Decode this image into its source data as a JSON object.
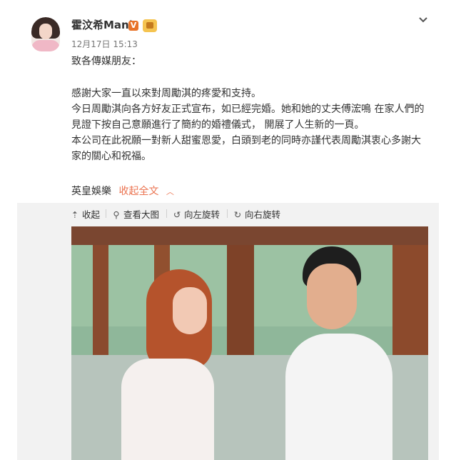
{
  "post": {
    "username": "霍汶希Mani",
    "verified_mark": "V",
    "timestamp": "12月17日 15:13",
    "greeting": "致各傳媒朋友：",
    "lines": [
      "感謝大家一直以來對周勵淇的疼愛和支持。",
      "今日周勵淇向各方好友正式宣布，如已經完婚。她和她的丈夫傅浤鳴 在家人們的",
      "見證下按自己意願進行了簡約的婚禮儀式， 開展了人生新的一頁。",
      "本公司在此祝願一對新人甜蜜恩愛，白頭到老的同時亦謹代表周勵淇衷心多謝大",
      "家的關心和祝福。"
    ],
    "source": "英皇娛樂",
    "collapse_label": "收起全文",
    "collapse_icon": "chevron-up-icon"
  },
  "viewer_toolbar": {
    "collapse": "收起",
    "view_large": "查看大图",
    "rotate_left": "向左旋转",
    "rotate_right": "向右旋转"
  },
  "colors": {
    "accent": "#eb7350",
    "verified_badge": "#e8742a",
    "viewer_bg": "#f2f2f2"
  }
}
